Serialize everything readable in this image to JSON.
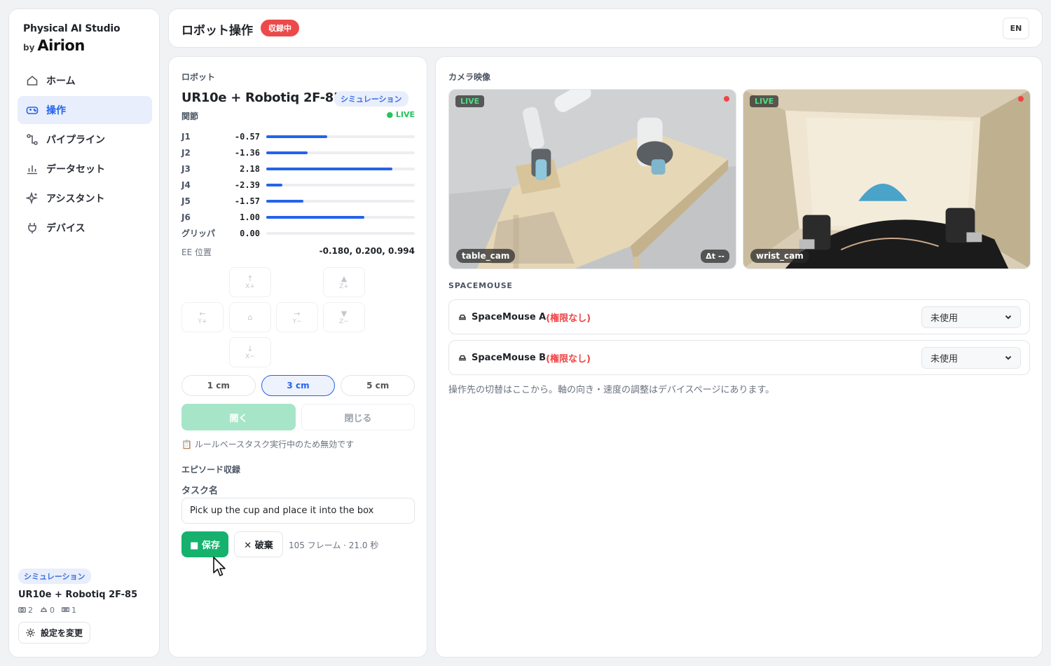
{
  "brand": {
    "title": "Physical AI Studio",
    "by": "by",
    "name": "Airion"
  },
  "sidebar": {
    "items": [
      {
        "label": "ホーム",
        "icon": "home-icon",
        "active": false
      },
      {
        "label": "操作",
        "icon": "gamepad-icon",
        "active": true
      },
      {
        "label": "パイプライン",
        "icon": "pipeline-icon",
        "active": false
      },
      {
        "label": "データセット",
        "icon": "bar-chart-icon",
        "active": false
      },
      {
        "label": "アシスタント",
        "icon": "sparkle-icon",
        "active": false
      },
      {
        "label": "デバイス",
        "icon": "plug-icon",
        "active": false
      }
    ],
    "mode_badge": "シミュレーション",
    "robot": "UR10e + Robotiq 2F-85",
    "counts": {
      "cameras": "2",
      "spacemice": "0",
      "keyboards": "1"
    },
    "settings_label": "設定を変更"
  },
  "header": {
    "title": "ロボット操作",
    "recording_badge": "収録中",
    "lang": "EN"
  },
  "robot_panel": {
    "section": "ロボット",
    "name": "UR10e + Robotiq 2F-85",
    "mode_badge": "シミュレーション",
    "joints_label": "関節",
    "live": "● LIVE",
    "joints": [
      {
        "name": "J1",
        "value": "-0.57",
        "level": 0.41
      },
      {
        "name": "J2",
        "value": "-1.36",
        "level": 0.28
      },
      {
        "name": "J3",
        "value": "2.18",
        "level": 0.85
      },
      {
        "name": "J4",
        "value": "-2.39",
        "level": 0.11
      },
      {
        "name": "J5",
        "value": "-1.57",
        "level": 0.25
      },
      {
        "name": "J6",
        "value": "1.00",
        "level": 0.66
      },
      {
        "name": "グリッパ",
        "value": "0.00",
        "level": 0
      }
    ],
    "ee_label": "EE 位置",
    "ee_value": "-0.180, 0.200, 0.994",
    "jog": {
      "x_plus": {
        "arrow": "↑",
        "label": "X+"
      },
      "z_plus": {
        "arrow": "▲",
        "label": "Z+"
      },
      "y_plus": {
        "arrow": "←",
        "label": "Y+"
      },
      "home": {
        "arrow": "⌂"
      },
      "y_minus": {
        "arrow": "→",
        "label": "Y−"
      },
      "z_minus": {
        "arrow": "▼",
        "label": "Z−"
      },
      "x_minus": {
        "arrow": "↓",
        "label": "X−"
      }
    },
    "steps": [
      "1 cm",
      "3 cm",
      "5 cm"
    ],
    "active_step": "3 cm",
    "gripper_open": "開く",
    "gripper_close": "閉じる",
    "gripper_note": "📋 ルールベースタスク実行中のため無効です",
    "episode_label": "エピソード収録",
    "task_label": "タスク名",
    "task_value": "Pick up the cup and place it into the box",
    "save_label": "■ 保存",
    "discard_label": "✕ 破棄",
    "frame_info": "105 フレーム · 21.0 秒"
  },
  "camera_panel": {
    "section": "カメラ映像",
    "cameras": [
      {
        "name": "table_cam",
        "live": "LIVE",
        "dt": "Δt --"
      },
      {
        "name": "wrist_cam",
        "live": "LIVE"
      }
    ],
    "spacemouse_label": "SPACEMOUSE",
    "spacemice": [
      {
        "name": "SpaceMouse A",
        "perm": "(権限なし)",
        "selection": "未使用"
      },
      {
        "name": "SpaceMouse B",
        "perm": "(権限なし)",
        "selection": "未使用"
      }
    ],
    "note": "操作先の切替はここから。軸の向き・速度の調整はデバイスページにあります。"
  },
  "colors": {
    "accent": "#2563eb",
    "recording": "#ec4a4a",
    "save": "#16b26d",
    "live": "#22c55e"
  }
}
